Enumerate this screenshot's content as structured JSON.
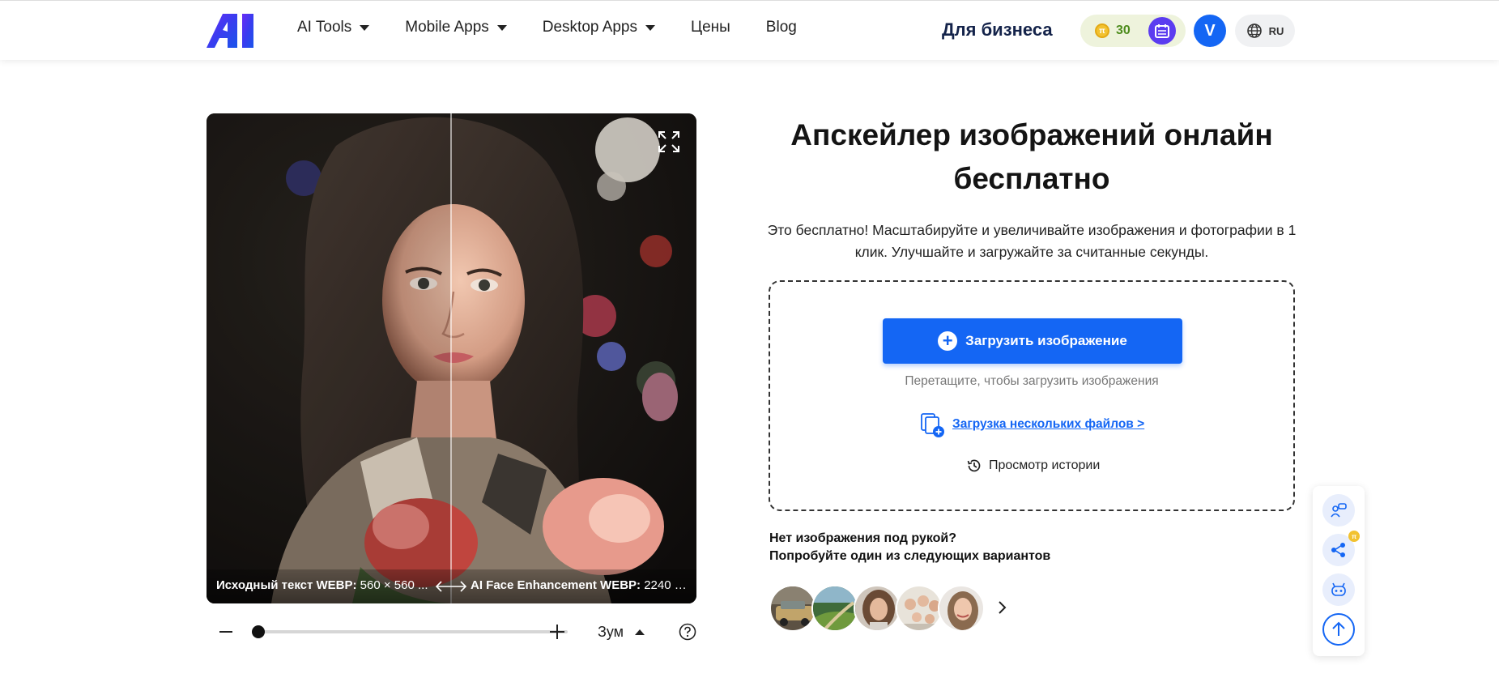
{
  "header": {
    "logo_text": "AI",
    "nav": [
      {
        "label": "AI Tools",
        "has_dropdown": true
      },
      {
        "label": "Mobile Apps",
        "has_dropdown": true
      },
      {
        "label": "Desktop Apps",
        "has_dropdown": true
      },
      {
        "label": "Цены",
        "has_dropdown": false
      },
      {
        "label": "Blog",
        "has_dropdown": false
      }
    ],
    "business_label": "Для бизнеса",
    "credits": "30",
    "avatar_initial": "V",
    "language": "RU"
  },
  "compare": {
    "left_label_bold": "Исходный текст WEBP:",
    "left_label_value": " 560 × 560 ...",
    "right_label_bold": "AI Face Enhancement WEBP:",
    "right_label_value": " 2240 × ..."
  },
  "zoom": {
    "label": "Зум",
    "level": 0
  },
  "main": {
    "title": "Апскейлер изображений онлайн бесплатно",
    "subtitle": "Это бесплатно! Масштабируйте и увеличивайте изображения и фотографии в 1 клик. Улучшайте и загружайте за считанные секунды.",
    "upload_button": "Загрузить изображение",
    "drag_hint": "Перетащите, чтобы загрузить изображения",
    "multi_upload": "Загрузка нескольких файлов >",
    "history": "Просмотр истории",
    "no_image_line1": "Нет изображения под рукой?",
    "no_image_line2": "Попробуйте один из следующих вариантов"
  },
  "samples": [
    "old-car",
    "landscape-road",
    "woman-portrait",
    "group-photo",
    "smiling-woman"
  ],
  "colors": {
    "accent": "#1466f4",
    "business_text": "#14234a",
    "credits_bg": "#eef3dc",
    "credits_text": "#4d8c1c"
  }
}
